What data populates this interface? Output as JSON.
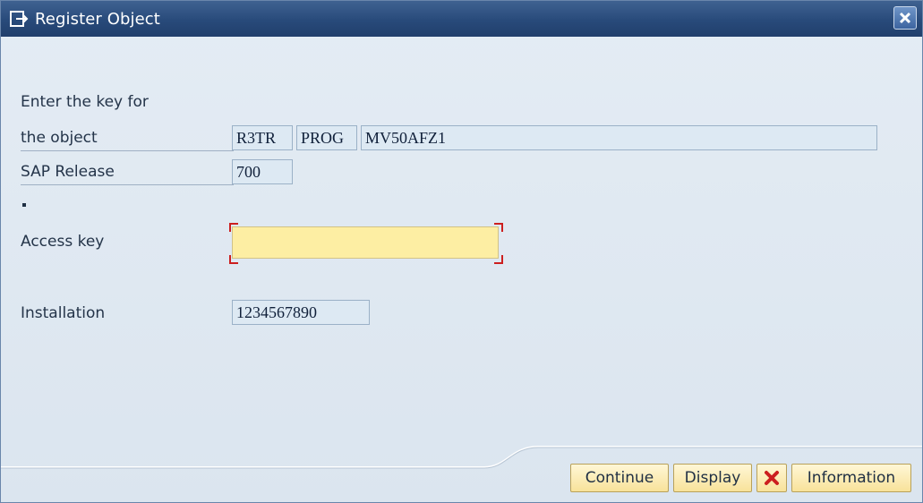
{
  "window": {
    "title": "Register Object",
    "close_icon": "close-icon"
  },
  "form": {
    "key_label_line1": "Enter the key for",
    "key_label_line2": "the object",
    "pgmid": "R3TR",
    "object_type": "PROG",
    "object_name": "MV50AFZ1",
    "release_label": "SAP Release",
    "release_value": "700",
    "separator_dot": ".",
    "access_key_label": "Access key",
    "access_key_value": "",
    "installation_label": "Installation",
    "installation_value": "1234567890"
  },
  "buttons": {
    "continue": "Continue",
    "display": "Display",
    "cancel_icon": "cancel-icon",
    "information": "Information"
  },
  "colors": {
    "titlebar": "#284a7a",
    "background": "#dbe5ef",
    "field": "#dde9f3",
    "required_field": "#fdeea3",
    "button": "#f8e29a",
    "cancel_red": "#cc1f1f"
  }
}
